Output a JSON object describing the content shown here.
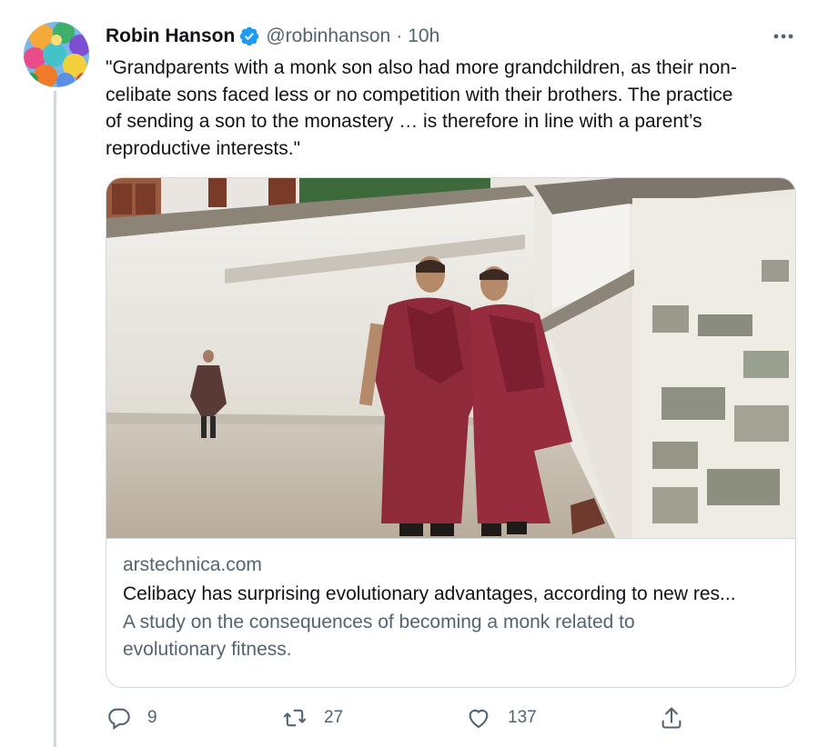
{
  "tweet": {
    "author_name": "Robin Hanson",
    "handle": "@robinhanson",
    "separator": "·",
    "time": "10h",
    "text": "\"Grandparents with a monk son also had more grandchildren, as their non-\ncelibate sons faced less or no competition with their brothers. The practice\nof sending a son to the monastery … is therefore in line with a parent’s\nreproductive interests.\""
  },
  "card": {
    "domain": "arstechnica.com",
    "title": "Celibacy has surprising evolutionary advantages, according to new res...",
    "description": "A study on the consequences of becoming a monk related to\nevolutionary fitness."
  },
  "actions": {
    "replies": "9",
    "retweets": "27",
    "likes": "137"
  },
  "icons": [
    "verified-badge-icon",
    "more-icon",
    "reply-icon",
    "retweet-icon",
    "like-icon",
    "share-icon"
  ],
  "colors": {
    "verified": "#1d9bf0",
    "secondary_text": "#536471",
    "primary_text": "#0f1419",
    "border": "#cfd9de"
  }
}
